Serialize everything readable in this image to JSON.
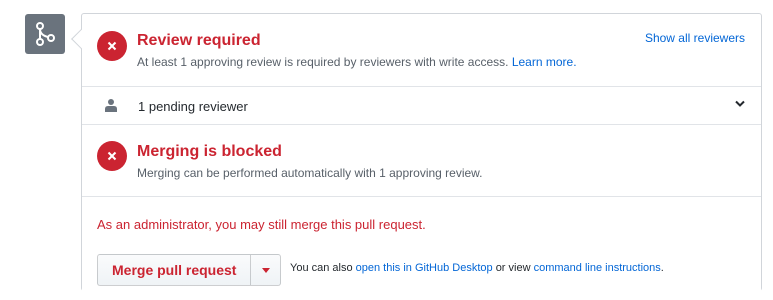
{
  "review": {
    "title": "Review required",
    "description": "At least 1 approving review is required by reviewers with write access.",
    "learn_more": "Learn more.",
    "show_all": "Show all reviewers"
  },
  "pending": {
    "label": "1 pending reviewer"
  },
  "blocked": {
    "title": "Merging is blocked",
    "description": "Merging can be performed automatically with 1 approving review."
  },
  "admin": {
    "notice": "As an administrator, you may still merge this pull request.",
    "merge_button": "Merge pull request",
    "also_prefix": "You can also",
    "desktop_link": "open this in GitHub Desktop",
    "or_view": "or view",
    "cli_link": "command line instructions",
    "period": "."
  },
  "colors": {
    "error": "#cb2431",
    "link": "#0366d6",
    "icon_bg": "#6a737d"
  },
  "icons": {
    "branch": "git-merge-icon",
    "status": "x-circle-icon",
    "reviewer": "person-icon",
    "expand": "chevron-down-icon",
    "menu": "triangle-down-icon"
  }
}
